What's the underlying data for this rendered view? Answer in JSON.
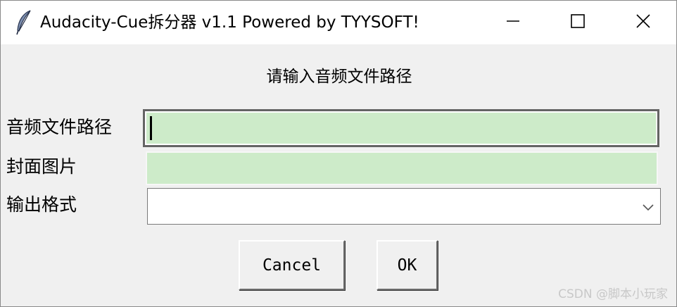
{
  "window": {
    "title": "Audacity-Cue拆分器 v1.1 Powered by TYYSOFT!",
    "controls": {
      "minimize_icon": "minimize-icon",
      "maximize_icon": "maximize-icon",
      "close_icon": "close-icon"
    },
    "app_icon": "feather-icon"
  },
  "form": {
    "prompt": "请输入音频文件路径",
    "audio_path": {
      "label": "音频文件路径",
      "value": ""
    },
    "cover_image": {
      "label": "封面图片",
      "value": ""
    },
    "output_format": {
      "label": "输出格式",
      "selected": ""
    }
  },
  "buttons": {
    "cancel": "Cancel",
    "ok": "OK"
  },
  "watermark": "CSDN @脚本小玩家",
  "colors": {
    "entry_background": "#cdebc9",
    "window_background": "#f0f0f0",
    "titlebar_background": "#ffffff"
  }
}
